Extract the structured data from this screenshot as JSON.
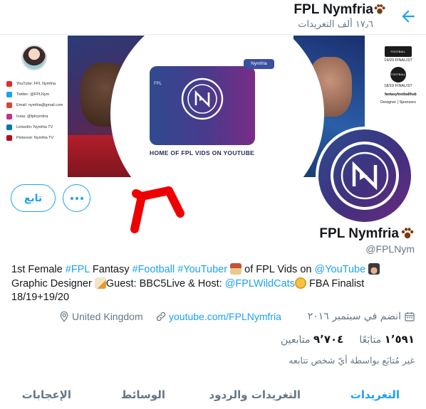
{
  "header": {
    "title": "FPL Nymfria",
    "subtitle": "١٧٫٦ ألف التغريدات",
    "back_icon": "back-arrow-icon",
    "accent": "#1da1f2"
  },
  "banner": {
    "yt_badge": "Nymfria",
    "yt_card_label": "FPL",
    "caption": "HOME OF FPL VIDS ON YOUTUBE",
    "socials": [
      {
        "label": "YouTube: FPL Nymfria",
        "color": "#e52d27"
      },
      {
        "label": "Twitter: @FPLNym",
        "color": "#1da1f2"
      },
      {
        "label": "Email: nymfria@gmail.com",
        "color": "#d44638"
      },
      {
        "label": "Insta: @fplnymfria",
        "color": "#c13584"
      },
      {
        "label": "LinkedIn: Nymfria TV",
        "color": "#0077b5"
      },
      {
        "label": "Pinterest: Nymfria TV",
        "color": "#bd081c"
      }
    ],
    "awards": [
      {
        "logo": "FOOTBALL CONTENT",
        "text": "19/20 FINALIST"
      },
      {
        "logo": "FOOTBALL BLOGGING",
        "text": "18/19 FINALIST"
      },
      {
        "logo": "fantasyfootballhub",
        "text": "Designer | Sponsors"
      }
    ]
  },
  "profile": {
    "name": "FPL Nymfria",
    "handle": "@FPLNym",
    "follow_label": "تابع",
    "bio": {
      "p1": "1st Female ",
      "tag1": "#FPL",
      "p2": " Fantasy ",
      "tag2": "#Football",
      "p3": " ",
      "tag3": "#YouTuber",
      "p4": " of FPL Vids on ",
      "mention1": "@YouTube",
      "p5": " Graphic Designer ",
      "p6": "Guest: BBC5Live & Host: ",
      "mention2": "@FPLWildCats",
      "p7": " FBA Finalist 18/19+19/20"
    },
    "location": "United Kingdom",
    "website": "youtube.com/FPLNymfria",
    "joined": "انضم في سبتمبر ٢٠١٦",
    "following_count": "١٬٥٩١",
    "following_label": "متابَعًا",
    "followers_count": "٩٬٧٠٤",
    "followers_label": "متابعين",
    "not_followed": "غير مُتابَع بواسطة أيّ شخص تتابعه"
  },
  "tabs": [
    {
      "label": "التغريدات",
      "active": true
    },
    {
      "label": "التغريدات والردود",
      "active": false
    },
    {
      "label": "الوسائط",
      "active": false
    },
    {
      "label": "الإعجابات",
      "active": false
    }
  ]
}
